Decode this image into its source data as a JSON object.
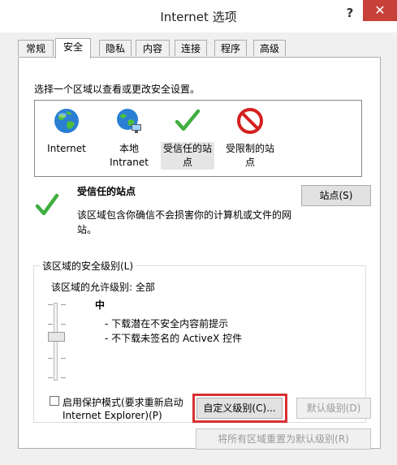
{
  "window": {
    "title": "Internet 选项"
  },
  "titlebar": {
    "help": "?",
    "close": "✕"
  },
  "tabs": [
    {
      "label": "常规"
    },
    {
      "label": "安全"
    },
    {
      "label": "隐私"
    },
    {
      "label": "内容"
    },
    {
      "label": "连接"
    },
    {
      "label": "程序"
    },
    {
      "label": "高级"
    }
  ],
  "security": {
    "instruction": "选择一个区域以查看或更改安全设置。",
    "zones": [
      {
        "label": "Internet",
        "icon": "globe-icon"
      },
      {
        "label": "本地 Intranet",
        "line1": "本地",
        "line2": "Intranet",
        "icon": "intranet-globe-icon"
      },
      {
        "label": "受信任的站点",
        "line1": "受信任的站",
        "line2": "点",
        "icon": "checkmark-icon"
      },
      {
        "label": "受限制的站点",
        "line1": "受限制的站",
        "line2": "点",
        "icon": "no-entry-icon"
      }
    ],
    "selected_zone": {
      "title": "受信任的站点",
      "description_line1": "该区域包含你确信不会损害你的计算机或文件的网",
      "description_line2": "站。",
      "sites_button": "站点(S)"
    },
    "level_group": {
      "title": "该区域的安全级别(L)",
      "allowed_levels": "该区域的允许级别: 全部",
      "current_level": "中",
      "bullet1": "- 下载潜在不安全内容前提示",
      "bullet2": "- 不下载未签名的 ActiveX 控件",
      "protected_mode_line1": "启用保护模式(要求重新启动",
      "protected_mode_line2": "Internet Explorer)(P)",
      "custom_level_button": "自定义级别(C)...",
      "default_level_button": "默认级别(D)"
    },
    "reset_all_button": "将所有区域重置为默认级别(R)"
  },
  "colors": {
    "accent_red": "#d93030",
    "check_green": "#3fae3f",
    "close_red": "#c7403a"
  }
}
